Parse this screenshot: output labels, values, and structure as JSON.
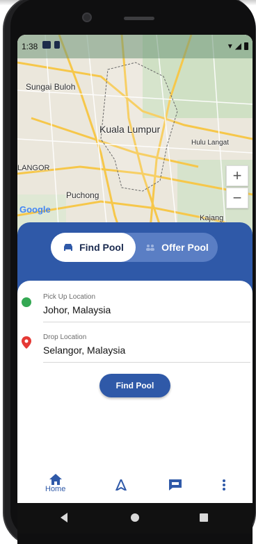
{
  "status_bar": {
    "time": "1:38"
  },
  "map": {
    "labels": {
      "sungai_buloh": "Sungai Buloh",
      "kuala_lumpur": "Kuala Lumpur",
      "hulu_langat": "Hulu Langat",
      "selangor": "LANGOR",
      "puchong": "Puchong",
      "kajang": "Kajang"
    },
    "zoom_in": "+",
    "zoom_out": "−",
    "attribution": "Google"
  },
  "toggle": {
    "find_label": "Find Pool",
    "offer_label": "Offer Pool"
  },
  "pickup": {
    "label": "Pick Up Location",
    "value": "Johor, Malaysia"
  },
  "drop": {
    "label": "Drop Location",
    "value": "Selangor, Malaysia"
  },
  "find_button": "Find Pool",
  "bottom_nav": {
    "home_label": "Home"
  },
  "colors": {
    "primary": "#2f59a8",
    "pickup_dot": "#34a853",
    "drop_pin": "#e53935"
  }
}
